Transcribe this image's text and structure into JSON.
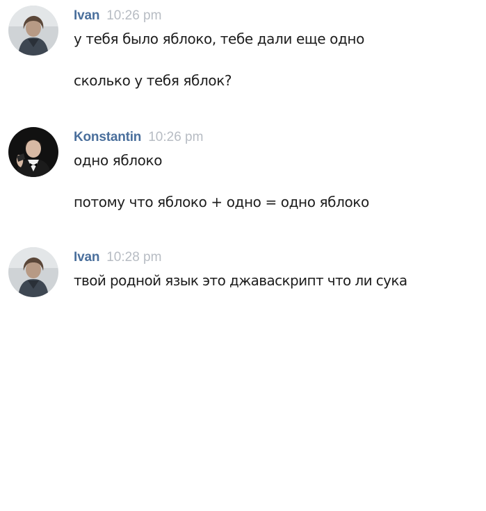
{
  "messages": [
    {
      "author": "Ivan",
      "time": "10:26 pm",
      "avatar": "ivan-avatar",
      "lines": [
        "у тебя было яблоко, тебе дали еще одно",
        "сколько у тебя яблок?"
      ]
    },
    {
      "author": "Konstantin",
      "time": "10:26 pm",
      "avatar": "konstantin-avatar",
      "lines": [
        "одно яблоко",
        "потому что яблоко + одно = одно яблоко"
      ]
    },
    {
      "author": "Ivan",
      "time": "10:28 pm",
      "avatar": "ivan-avatar",
      "lines": [
        "твой родной язык это джаваскрипт что ли сука"
      ]
    }
  ],
  "colors": {
    "author": "#4a6f9c",
    "time": "#b7bcc3",
    "text": "#1d1d1d",
    "background": "#ffffff"
  }
}
